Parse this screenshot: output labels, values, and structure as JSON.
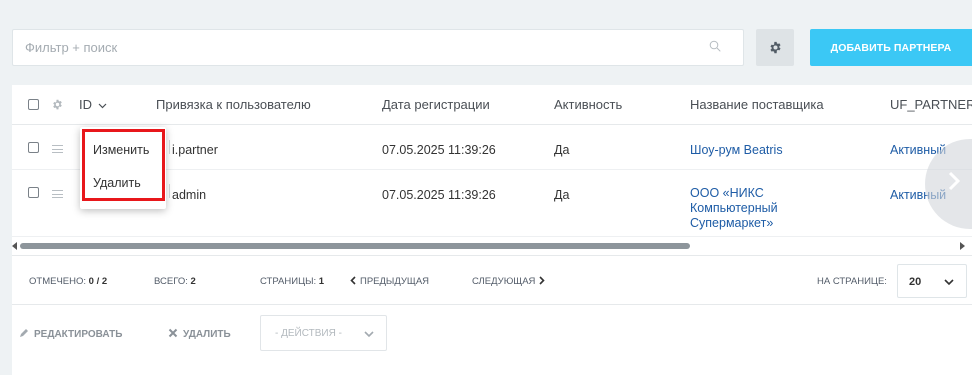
{
  "search": {
    "placeholder": "Фильтр + поиск",
    "icon": "magnifier-icon"
  },
  "toolbar": {
    "add_partner_label": "ДОБАВИТЬ ПАРТНЕРА",
    "settings_icon": "gear-icon"
  },
  "table": {
    "columns": [
      "ID",
      "Привязка к пользователю",
      "Дата регистрации",
      "Активность",
      "Название поставщика",
      "UF_PARTNER"
    ],
    "rows": [
      {
        "user": "i.partner",
        "date": "07.05.2025 11:39:26",
        "active": "Да",
        "supplier": "Шоу-рум Beatris",
        "status": "Активный"
      },
      {
        "user": "admin",
        "date": "07.05.2025 11:39:26",
        "active": "Да",
        "supplier_lines": [
          "ООО «НИКС",
          "Компьютерный",
          "Супермаркет»"
        ],
        "status": "Активный"
      }
    ]
  },
  "context_menu": {
    "edit": "Изменить",
    "delete": "Удалить"
  },
  "footer": {
    "selected_label": "ОТМЕЧЕНО:",
    "selected_value": "0 / 2",
    "total_label": "ВСЕГО:",
    "total_value": "2",
    "pages_label": "СТРАНИЦЫ:",
    "pages_value": "1",
    "prev": "ПРЕДЫДУЩАЯ",
    "next": "СЛЕДУЮЩАЯ",
    "per_page_label": "НА СТРАНИЦЕ:",
    "per_page_value": "20"
  },
  "actions": {
    "edit": "РЕДАКТИРОВАТЬ",
    "delete": "УДАЛИТЬ",
    "select_placeholder": "- ДЕЙСТВИЯ -"
  },
  "colors": {
    "accent": "#3bc8f5",
    "link": "#1e5ca6",
    "highlight": "#e8171b"
  }
}
